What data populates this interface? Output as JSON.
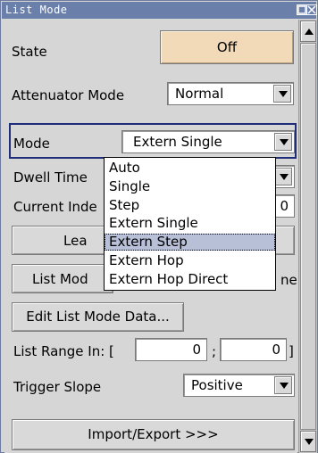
{
  "window": {
    "title": "List Mode"
  },
  "state": {
    "label": "State",
    "button": "Off"
  },
  "attenuator": {
    "label": "Attenuator Mode",
    "value": "Normal"
  },
  "mode": {
    "label": "Mode",
    "value": "Extern Single",
    "options": [
      "Auto",
      "Single",
      "Step",
      "Extern Single",
      "Extern Step",
      "Extern Hop",
      "Extern Hop Direct"
    ],
    "highlighted": "Extern Step"
  },
  "dwell": {
    "label": "Dwell Time"
  },
  "current_index": {
    "label": "Current Inde",
    "value": "0"
  },
  "learn": {
    "label": "Lea"
  },
  "list_mode_btn": {
    "label": "List Mod",
    "suffix": "ne"
  },
  "edit_button": "Edit List Mode Data...",
  "list_range": {
    "label": "List Range In: [",
    "from": "0",
    "sep": ";",
    "to": "0",
    "close": "]"
  },
  "trigger_slope": {
    "label": "Trigger Slope",
    "value": "Positive"
  },
  "import_export": "Import/Export >>>",
  "colors": {
    "titlebar": "#6b7fab",
    "focus": "#1f2c7a",
    "off_button": "#f2d9b8",
    "highlight": "#b8c0d8"
  }
}
